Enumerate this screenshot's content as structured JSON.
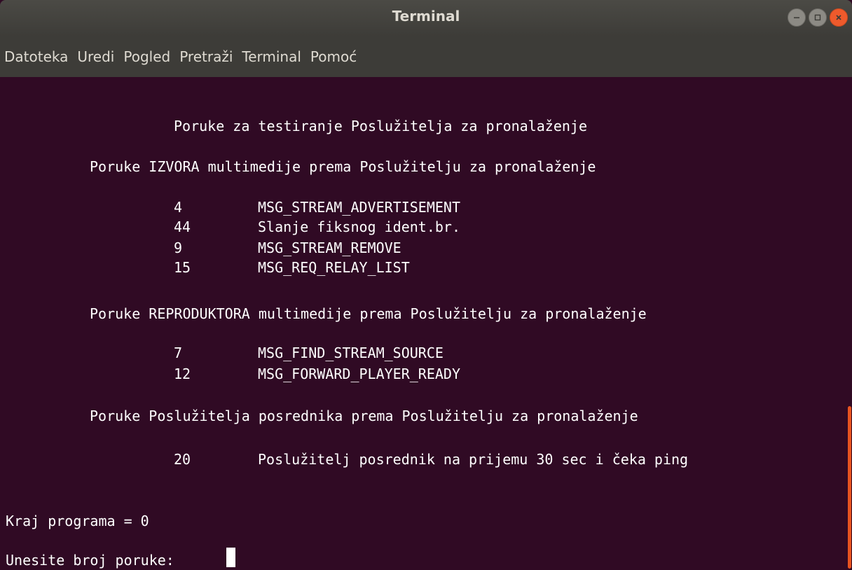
{
  "window": {
    "title": "Terminal",
    "minimize_icon": "minus-icon",
    "maximize_icon": "square-icon",
    "close_icon": "x-icon"
  },
  "menu": {
    "items": [
      "Datoteka",
      "Uredi",
      "Pogled",
      "Pretraži",
      "Terminal",
      "Pomoć"
    ]
  },
  "terminal": {
    "heading": "Poruke za testiranje Poslužitelja za pronalaženje",
    "section1_title": "Poruke IZVORA multimedije prema Poslužitelju za pronalaženje",
    "section1_rows": [
      {
        "code": "4",
        "text": "MSG_STREAM_ADVERTISEMENT"
      },
      {
        "code": "44",
        "text": "Slanje fiksnog ident.br."
      },
      {
        "code": "9",
        "text": "MSG_STREAM_REMOVE"
      },
      {
        "code": "15",
        "text": "MSG_REQ_RELAY_LIST"
      }
    ],
    "section2_title": "Poruke REPRODUKTORA multimedije prema Poslužitelju za pronalaženje",
    "section2_rows": [
      {
        "code": "7",
        "text": "MSG_FIND_STREAM_SOURCE"
      },
      {
        "code": "12",
        "text": "MSG_FORWARD_PLAYER_READY"
      }
    ],
    "section3_title": "Poruke Poslužitelja posrednika prema Poslužitelju za pronalaženje",
    "section3_rows": [
      {
        "code": "20",
        "text": "Poslužitelj posrednik na prijemu 30 sec i čeka ping"
      }
    ],
    "exit_line": "Kraj programa = 0",
    "prompt": "Unesite broj poruke:"
  },
  "colors": {
    "terminal_bg": "#300a24",
    "titlebar_bg": "#3d3c38",
    "text": "#ffffff",
    "accent": "#e95420"
  }
}
